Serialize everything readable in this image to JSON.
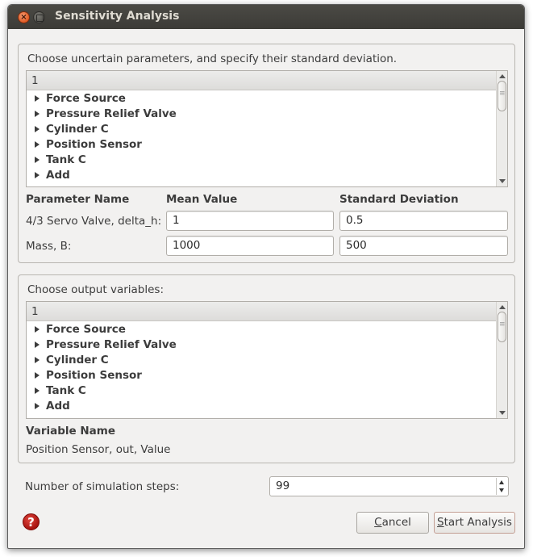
{
  "window": {
    "title": "Sensitivity Analysis"
  },
  "params_group": {
    "title": "Choose uncertain parameters, and specify their standard deviation.",
    "list_header": "1",
    "items": [
      "Force Source",
      "Pressure Relief Valve",
      "Cylinder C",
      "Position Sensor",
      "Tank C",
      "Add"
    ],
    "col_param": "Parameter Name",
    "col_mean": "Mean Value",
    "col_std": "Standard Deviation",
    "rows": [
      {
        "name": "4/3 Servo Valve, delta_h:",
        "mean": "1",
        "std": "0.5"
      },
      {
        "name": "Mass, B:",
        "mean": "1000",
        "std": "500"
      }
    ]
  },
  "outputs_group": {
    "title": "Choose output variables:",
    "list_header": "1",
    "items": [
      "Force Source",
      "Pressure Relief Valve",
      "Cylinder C",
      "Position Sensor",
      "Tank C",
      "Add"
    ],
    "col_variable": "Variable Name",
    "selected_variable": "Position Sensor, out, Value"
  },
  "steps": {
    "label": "Number of simulation steps:",
    "value": "99"
  },
  "footer": {
    "help_icon": "?",
    "cancel_mnemonic": "C",
    "cancel_rest": "ancel",
    "start_mnemonic": "S",
    "start_rest": "tart Analysis"
  }
}
